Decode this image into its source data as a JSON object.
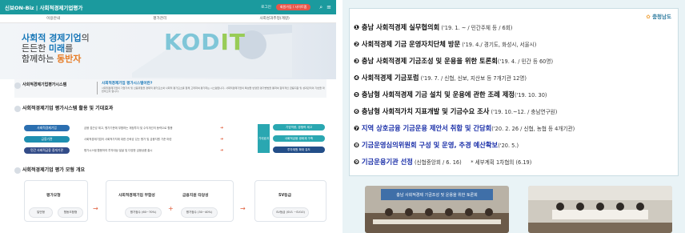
{
  "left": {
    "topbar": {
      "brand": "신보ON-Biz | 사회적경제기업평가",
      "login": "로그인",
      "pill": "회원가입 / 사이트맵"
    },
    "nav": [
      "이용안내",
      "평가관리",
      "사회성과추정(계량)"
    ],
    "hero": {
      "line1a": "사회적 경제기업",
      "line1b": "의",
      "line2a": "든든한 ",
      "line2b": "미래",
      "line2c": "를",
      "line3a": "함께하는 ",
      "line3b": "동반자",
      "logo_k": "K",
      "logo_od": "OD",
      "logo_it": "IT"
    },
    "sec1": {
      "title": "사회적경제기업평가시스템",
      "q": "사회적경제기업 평가시스템이란?",
      "desc": "사회적경제기업의 기업가치 및 신용위험을 경제적 평가요소와 사회적 평가요소를 함께 고려하여 평가하는 시스템입니다. 사회적경제기업의 특성을 반영한 평가방법을 통하여 합리적인 금융지원 및 성과관리의 기반을 마련하고자 합니다."
    },
    "sec2": {
      "title": "사회적경제기업 평가시스템 활용 및 기대효과",
      "rows": [
        {
          "label": "사회적경제기업",
          "text": "금융 접근성 제고, 평가기준에 부합하는 재정투자 및 수익개선의 동력으로 활용"
        },
        {
          "label": "금융기관",
          "text": "사회적경제기업의 사회적가치에 대한 신뢰성 있는 평가 및 금융지원 기준 마련"
        },
        {
          "label": "민간 사회적금융 중개기관",
          "text": "평가시스템 활용하여 투자대상 발굴 및 다양한 금융상품 출시"
        }
      ],
      "effect": "기대효과",
      "results": [
        "기업역량, 경쟁력 제고",
        "사회적금융 생태계 구축",
        "투자재원 확대 유도"
      ]
    },
    "sec3": {
      "title": "사회적경제기업 평가 모형 개요",
      "boxes": [
        {
          "title": "평가모형",
          "chips": [
            "일반형",
            "협동조합형"
          ]
        },
        {
          "title": "사회적경제기업 부합성",
          "chip": "평가점수 (60~70%)"
        },
        {
          "title": "금융지원 타당성",
          "chip": "평가점수 (30~40%)"
        },
        {
          "title": "SV등급",
          "chip": "SV등급 (SV1 ~SV10)"
        }
      ],
      "plus": "+"
    }
  },
  "right": {
    "logo": "충청남도",
    "items": [
      {
        "num": "❶",
        "main": "충남 사회적경제 실무협의회",
        "detail": " ('19. 1. ~ / 민간주체 등  / 6회)"
      },
      {
        "num": "❷",
        "main": "사회적경제 기금 운영자치단체 방문",
        "detail": " ('19. 4./ 경기도, 화성시, 서울시)"
      },
      {
        "num": "❸",
        "main": "충남 사회적경제 기금조성 및 운용을 위한 토론회",
        "detail": "('19. 4. / 민간 등 60명)"
      },
      {
        "num": "❹",
        "main": "사회적경제 기금포럼",
        "detail": " ('19. 7. / 신협, 신보, 지산보 등 7개기관 12명)"
      },
      {
        "num": "❺",
        "main": "충남형 사회적경제 기금 설치 및 운용에 관한 조례 제정",
        "detail": "('19. 10. 30)"
      },
      {
        "num": "❻",
        "main": "충남형 사회적가치 지표개발 및 기금수요 조사",
        "detail": " ('19. 10.~12. / 충남연구원)"
      },
      {
        "num": "❼",
        "main": "지역 상호금융 기금운용 제안서 취합 및 간담회",
        "detail": "('20. 2. 26 / 신협, 농협 등 4개기관)"
      },
      {
        "num": "❽",
        "main": "기금운영심의위원회 구성 및 운영, 추경 예산확보",
        "detail": "('20. 5.)"
      },
      {
        "num": "❾",
        "main": "기금운용기관 선정",
        "detail": " (신협중앙회 / 6. 16)",
        "note": "* 세부계획 1차협의 (6.19)"
      }
    ],
    "banner": "충남 사회적경제 기금조성 및 운용을 위한 토론회"
  }
}
